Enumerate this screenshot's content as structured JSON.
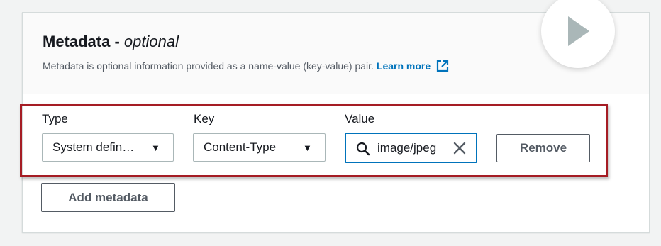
{
  "metadata": {
    "title": "Metadata - ",
    "title_optional": "optional",
    "description": "Metadata is optional information provided as a name-value (key-value) pair.",
    "learn_more": "Learn more"
  },
  "fields": {
    "type_label": "Type",
    "key_label": "Key",
    "value_label": "Value"
  },
  "row": {
    "type_value": "System defin…",
    "key_value": "Content-Type",
    "value_value": "image/jpeg"
  },
  "buttons": {
    "remove": "Remove",
    "add_metadata": "Add metadata"
  },
  "colors": {
    "link": "#0073bb",
    "highlight": "#a51c24",
    "focus": "#0073bb"
  },
  "icons": {
    "external": "external-link-icon",
    "caret": "caret-down-icon",
    "search": "search-icon",
    "clear": "close-icon",
    "play": "play-icon"
  }
}
